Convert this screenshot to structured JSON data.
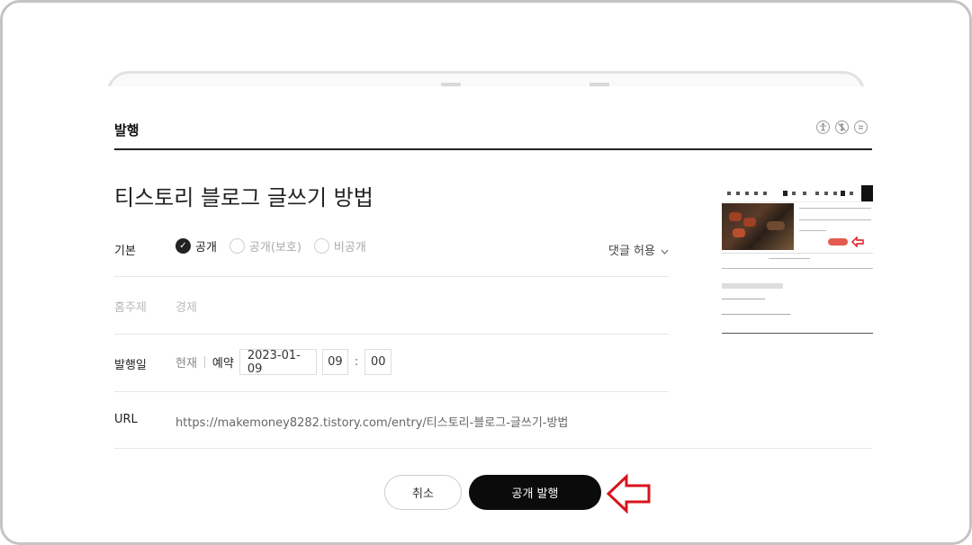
{
  "modal": {
    "title": "발행",
    "post_title": "티스토리 블로그 글쓰기 방법"
  },
  "visibility": {
    "label": "기본",
    "options": [
      {
        "label": "공개",
        "selected": true
      },
      {
        "label": "공개(보호)",
        "selected": false
      },
      {
        "label": "비공개",
        "selected": false
      }
    ],
    "comment_option": "댓글 허용"
  },
  "category": {
    "label": "홈주제",
    "value": "경제"
  },
  "publish_date": {
    "label": "발행일",
    "now_label": "현재",
    "reserve_label": "예약",
    "date": "2023-01-09",
    "hour": "09",
    "minute": "00"
  },
  "url": {
    "label": "URL",
    "value": "https://makemoney8282.tistory.com/entry/티스토리-블로그-글쓰기-방법"
  },
  "buttons": {
    "cancel": "취소",
    "publish": "공개 발행"
  },
  "colors": {
    "accent": "#0b0b0b",
    "arrow": "#d9141c",
    "muted_text": "#b8b8b8"
  },
  "icons": [
    "accessibility-icon",
    "no-dollar-icon",
    "menu-circle-icon",
    "check-icon",
    "chevron-down-icon",
    "left-arrow-icon"
  ]
}
